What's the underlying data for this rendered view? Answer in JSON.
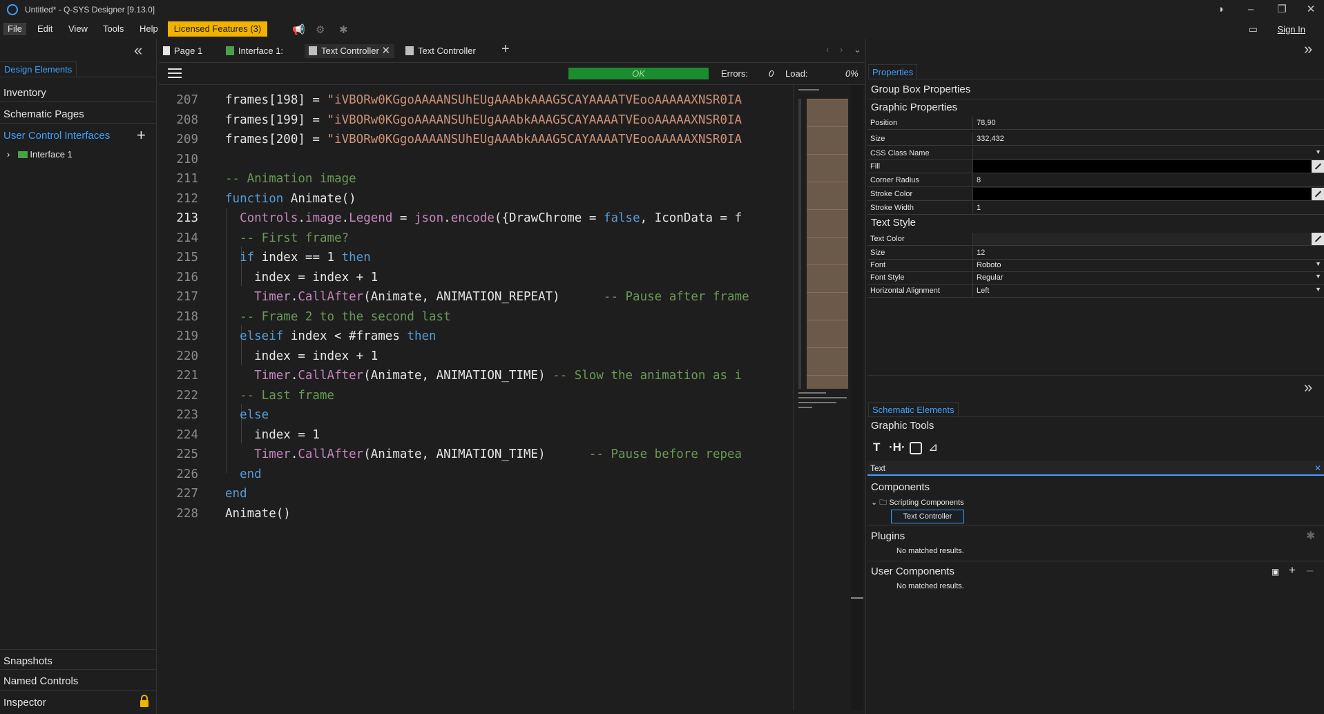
{
  "window": {
    "title": "Untitled* - Q-SYS Designer [9.13.0]",
    "sign_in": "Sign In"
  },
  "menu": {
    "file": "File",
    "edit": "Edit",
    "view": "View",
    "tools": "Tools",
    "help": "Help",
    "licensed": "Licensed Features (3)"
  },
  "left_panel": {
    "tab": "Design Elements",
    "items": [
      "Inventory",
      "Schematic Pages",
      "User Control Interfaces"
    ],
    "tree_item": "Interface 1",
    "bottom_items": [
      "Snapshots",
      "Named Controls",
      "Inspector"
    ]
  },
  "doc_tabs": [
    "Page 1",
    "Interface 1:",
    "Text Controller",
    "Text Controller"
  ],
  "status": {
    "ok": "OK",
    "errors_label": "Errors:",
    "errors_value": "0",
    "load_label": "Load:",
    "load_value": "0%"
  },
  "code": {
    "current_line": 213,
    "lines": [
      {
        "n": "207",
        "html": "frames[198] = <span class='s'>\"iVBORw0KGgoAAAANSUhEUgAAAbkAAAG5CAYAAAATVEooAAAAAXNSR0IA</span>"
      },
      {
        "n": "208",
        "html": "frames[199] = <span class='s'>\"iVBORw0KGgoAAAANSUhEUgAAAbkAAAG5CAYAAAATVEooAAAAAXNSR0IA</span>"
      },
      {
        "n": "209",
        "html": "frames[200] = <span class='s'>\"iVBORw0KGgoAAAANSUhEUgAAAbkAAAG5CAYAAAATVEooAAAAAXNSR0IA</span>"
      },
      {
        "n": "210",
        "html": ""
      },
      {
        "n": "211",
        "html": "<span class='c'>-- Animation image</span>"
      },
      {
        "n": "212",
        "html": "<span class='k'>function</span> Animate()"
      },
      {
        "n": "213",
        "html": "  <span class='f'>Controls</span>.<span class='f'>image</span>.<span class='f'>Legend</span> = <span class='f'>json</span>.<span class='f'>encode</span>({DrawChrome = <span class='b'>false</span>, IconData = f"
      },
      {
        "n": "214",
        "html": "  <span class='c'>-- First frame?</span>"
      },
      {
        "n": "215",
        "html": "  <span class='k'>if</span> index == 1 <span class='k'>then</span>"
      },
      {
        "n": "216",
        "html": "    index = index + 1"
      },
      {
        "n": "217",
        "html": "    <span class='f'>Timer</span>.<span class='f'>CallAfter</span>(Animate, ANIMATION_REPEAT)      <span class='c'>-- Pause after frame</span>"
      },
      {
        "n": "218",
        "html": "  <span class='c'>-- Frame 2 to the second last</span>"
      },
      {
        "n": "219",
        "html": "  <span class='k'>elseif</span> index &lt; #frames <span class='k'>then</span>"
      },
      {
        "n": "220",
        "html": "    index = index + 1"
      },
      {
        "n": "221",
        "html": "    <span class='f'>Timer</span>.<span class='f'>CallAfter</span>(Animate, ANIMATION_TIME) <span class='c'>-- Slow the animation as i</span>"
      },
      {
        "n": "222",
        "html": "  <span class='c'>-- Last frame</span>"
      },
      {
        "n": "223",
        "html": "  <span class='k'>else</span>"
      },
      {
        "n": "224",
        "html": "    index = 1"
      },
      {
        "n": "225",
        "html": "    <span class='f'>Timer</span>.<span class='f'>CallAfter</span>(Animate, ANIMATION_TIME)      <span class='c'>-- Pause before repea</span>"
      },
      {
        "n": "226",
        "html": "  <span class='k'>end</span>"
      },
      {
        "n": "227",
        "html": "<span class='k'>end</span>"
      },
      {
        "n": "228",
        "html": "Animate()"
      }
    ]
  },
  "properties": {
    "tab": "Properties",
    "group_box": "Group Box Properties",
    "graphic": "Graphic Properties",
    "rows": [
      {
        "label": "Position",
        "value": "78,90"
      },
      {
        "label": "Size",
        "value": "332,432"
      },
      {
        "label": "CSS Class Name",
        "value": ""
      },
      {
        "label": "Fill",
        "value": ""
      },
      {
        "label": "Corner Radius",
        "value": "8"
      },
      {
        "label": "Stroke Color",
        "value": ""
      },
      {
        "label": "Stroke Width",
        "value": "1"
      }
    ],
    "text_style": "Text Style",
    "text_rows": [
      {
        "label": "Text Color",
        "value": ""
      },
      {
        "label": "Size",
        "value": "12"
      },
      {
        "label": "Font",
        "value": "Roboto"
      },
      {
        "label": "Font Style",
        "value": "Regular"
      },
      {
        "label": "Horizontal Alignment",
        "value": "Left"
      }
    ]
  },
  "schematic": {
    "tab": "Schematic Elements",
    "graphic_tools": "Graphic Tools",
    "search_value": "Text",
    "components": "Components",
    "scripting": "Scripting Components",
    "text_controller": "Text Controller",
    "plugins": "Plugins",
    "no_results": "No matched results.",
    "user_components": "User Components"
  },
  "colors": {
    "accent": "#3ea0ff",
    "licensed": "#f2b200",
    "ok": "#1b8d2e"
  }
}
